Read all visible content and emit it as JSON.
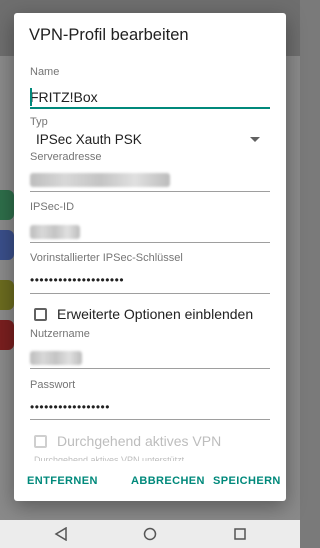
{
  "dialog": {
    "title": "VPN-Profil bearbeiten",
    "name": {
      "label": "Name",
      "value": "FRITZ!Box"
    },
    "type": {
      "label": "Typ",
      "value": "IPSec Xauth PSK"
    },
    "server": {
      "label": "Serveradresse"
    },
    "ipsec_id": {
      "label": "IPSec-ID"
    },
    "psk": {
      "label": "Vorinstallierter IPSec-Schlüssel",
      "value": "••••••••••••••••••••"
    },
    "advanced": {
      "label": "Erweiterte Optionen einblenden",
      "checked": false
    },
    "username": {
      "label": "Nutzername"
    },
    "password": {
      "label": "Passwort",
      "value": "•••••••••••••••••"
    },
    "always_on": {
      "label": "Durchgehend aktives VPN",
      "checked": false,
      "enabled": false
    },
    "always_on_hint": "Durchgehend aktives VPN unterstützt"
  },
  "actions": {
    "remove": "ENTFERNEN",
    "cancel": "ABBRECHEN",
    "save": "SPEICHERN"
  },
  "colors": {
    "accent": "#00897b"
  },
  "navbar": {
    "back": "back-triangle-icon",
    "home": "home-circle-icon",
    "recents": "recents-square-icon"
  }
}
